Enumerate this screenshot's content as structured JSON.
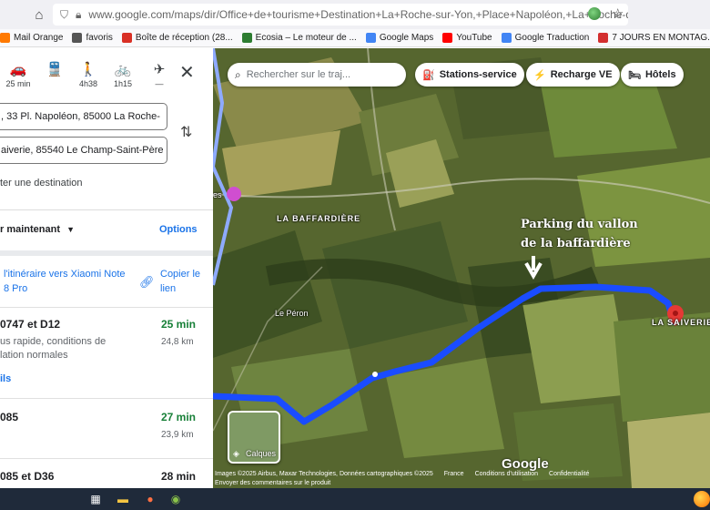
{
  "browser": {
    "url": "www.google.com/maps/dir/Office+de+tourisme+Destination+La+Roche-sur-Yon,+Place+Napoléon,+La+Roche-d",
    "bookmarks": [
      {
        "label": "Mail Orange",
        "icon": "mail-icon",
        "color": "#ff7900"
      },
      {
        "label": "favoris",
        "icon": "folder-icon",
        "color": "#555555"
      },
      {
        "label": "Boîte de réception (28...",
        "icon": "gmail-icon",
        "color": "#d93025"
      },
      {
        "label": "Ecosia – Le moteur de ...",
        "icon": "ecosia-icon",
        "color": "#2e7d32"
      },
      {
        "label": "Google Maps",
        "icon": "google-icon",
        "color": "#4285f4"
      },
      {
        "label": "YouTube",
        "icon": "youtube-icon",
        "color": "#ff0000"
      },
      {
        "label": "Google Traduction",
        "icon": "translate-icon",
        "color": "#4285f4"
      },
      {
        "label": "7 JOURS EN MONTAG...",
        "icon": "bookmark-icon",
        "color": "#d32f2f"
      }
    ]
  },
  "panel": {
    "modes": [
      {
        "icon": "car-icon",
        "glyph": "🚗",
        "label": "25 min",
        "active": true
      },
      {
        "icon": "car-alt-icon",
        "glyph": "🚘",
        "label": "",
        "active": false
      },
      {
        "icon": "transit-icon",
        "glyph": "🚆",
        "label": "",
        "active": false
      },
      {
        "icon": "walk-icon",
        "glyph": "🚶",
        "label": "4h38",
        "active": false
      },
      {
        "icon": "bike-icon",
        "glyph": "🚲",
        "label": "1h15",
        "active": false
      },
      {
        "icon": "flight-icon",
        "glyph": "✈",
        "label": "—",
        "active": false
      }
    ],
    "origin": ", 33 Pl. Napoléon, 85000 La Roche-",
    "destination": "aiverie, 85540 Le Champ-Saint-Père",
    "add_destination": "ter une destination",
    "depart": "r maintenant",
    "options": "Options",
    "send_to_phone": "l'itinéraire vers Xiaomi Note 8 Pro",
    "copy_link": "Copier le lien",
    "routes": [
      {
        "title": "0747 et D12",
        "desc": "us rapide, conditions de lation normales",
        "time": "25 min",
        "distance": "24,8 km",
        "time_color": "#188038",
        "details": "ils"
      },
      {
        "title": "085",
        "desc": "",
        "time": "27 min",
        "distance": "23,9 km",
        "time_color": "#188038",
        "details": ""
      },
      {
        "title": "085 et D36",
        "desc": "",
        "time": "28 min",
        "distance": "",
        "time_color": "#202124",
        "details": ""
      }
    ]
  },
  "map": {
    "search_placeholder": "Rechercher sur le traj...",
    "chips": [
      {
        "label": "Stations-service",
        "icon": "gas-station-icon"
      },
      {
        "label": "Recharge VE",
        "icon": "ev-charging-icon"
      },
      {
        "label": "Hôtels",
        "icon": "hotel-icon"
      }
    ],
    "places": {
      "baffardiere": "LA BAFFARDIÈRE",
      "peron": "Le Péron",
      "saiverie": "LA SAIVERIE",
      "es": "es"
    },
    "annotation_line1": "Parking du vallon",
    "annotation_line2": "de la baffardière",
    "layers_label": "Calques",
    "google_logo": "Google",
    "attribution": "Images ©2025 Airbus, Maxar Technologies, Données cartographiques ©2025",
    "country": "France",
    "terms": "Conditions d'utilisation",
    "privacy": "Confidentialité",
    "feedback": "Envoyer des commentaires sur le produit",
    "route_color": "#1a4cff",
    "destination_pin_color": "#e53935"
  }
}
